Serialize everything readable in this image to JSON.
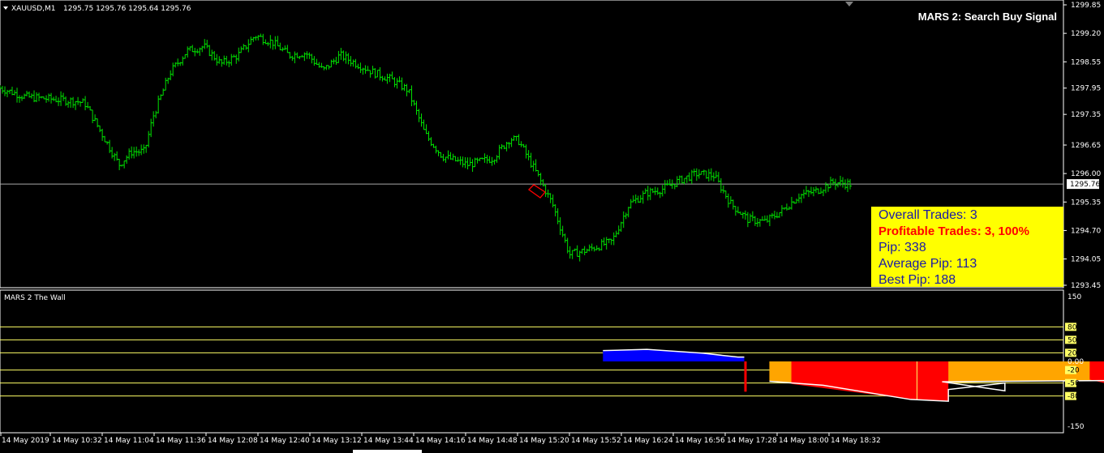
{
  "header": {
    "symbol": "XAUUSD,M1",
    "ohlc": "1295.75 1295.76 1295.64 1295.76",
    "signal": "MARS 2: Search Buy Signal"
  },
  "indicator_title": "MARS 2 The Wall",
  "stats": {
    "overall": "Overall Trades: 3",
    "profitable": "Profitable Trades: 3, 100%",
    "pip": "Pip: 338",
    "avg": "Average Pip: 113",
    "best": "Best Pip: 188"
  },
  "colors": {
    "candle": "#00e000",
    "hline": "#a8a8a8",
    "blue": "#0000ff",
    "orange": "#ffa500",
    "red": "#ff0000",
    "level": "#ffff66",
    "stats_bg": "#ffff00"
  },
  "chart_data": [
    {
      "type": "bar",
      "title": "XAUUSD,M1",
      "x_labels": [
        "14 May 2019",
        "14 May 10:32",
        "14 May 11:04",
        "14 May 11:36",
        "14 May 12:08",
        "14 May 12:40",
        "14 May 13:12",
        "14 May 13:44",
        "14 May 14:16",
        "14 May 14:48",
        "14 May 15:20",
        "14 May 15:52",
        "14 May 16:24",
        "14 May 16:56",
        "14 May 17:28",
        "14 May 18:00",
        "14 May 18:32"
      ],
      "y_ticks": [
        "1299.85",
        "1299.20",
        "1298.55",
        "1297.95",
        "1297.35",
        "1296.65",
        "1296.00",
        "1295.35",
        "1294.70",
        "1294.05",
        "1293.45"
      ],
      "ylim": [
        1293.45,
        1299.85
      ],
      "current_price": "1295.76",
      "price_path": [
        [
          0,
          1297.95
        ],
        [
          0.03,
          1297.75
        ],
        [
          0.06,
          1297.7
        ],
        [
          0.09,
          1297.65
        ],
        [
          0.1,
          1297.6
        ],
        [
          0.12,
          1296.9
        ],
        [
          0.14,
          1296.2
        ],
        [
          0.155,
          1296.5
        ],
        [
          0.17,
          1296.5
        ],
        [
          0.18,
          1297.3
        ],
        [
          0.2,
          1298.3
        ],
        [
          0.22,
          1298.8
        ],
        [
          0.24,
          1298.9
        ],
        [
          0.26,
          1298.5
        ],
        [
          0.28,
          1298.7
        ],
        [
          0.3,
          1299.15
        ],
        [
          0.32,
          1299.0
        ],
        [
          0.34,
          1298.7
        ],
        [
          0.36,
          1298.75
        ],
        [
          0.38,
          1298.35
        ],
        [
          0.4,
          1298.7
        ],
        [
          0.42,
          1298.5
        ],
        [
          0.44,
          1298.3
        ],
        [
          0.46,
          1298.15
        ],
        [
          0.48,
          1297.9
        ],
        [
          0.5,
          1296.9
        ],
        [
          0.52,
          1296.4
        ],
        [
          0.55,
          1296.2
        ],
        [
          0.58,
          1296.35
        ],
        [
          0.6,
          1296.8
        ],
        [
          0.61,
          1296.75
        ],
        [
          0.63,
          1296.05
        ],
        [
          0.65,
          1295.3
        ],
        [
          0.67,
          1294.15
        ],
        [
          0.69,
          1294.25
        ],
        [
          0.72,
          1294.45
        ],
        [
          0.74,
          1295.3
        ],
        [
          0.76,
          1295.55
        ],
        [
          0.78,
          1295.65
        ],
        [
          0.8,
          1295.85
        ],
        [
          0.82,
          1296.0
        ],
        [
          0.84,
          1295.95
        ],
        [
          0.86,
          1295.3
        ],
        [
          0.88,
          1294.95
        ],
        [
          0.9,
          1294.9
        ],
        [
          0.92,
          1295.15
        ],
        [
          0.94,
          1295.5
        ],
        [
          0.96,
          1295.6
        ],
        [
          0.98,
          1295.8
        ],
        [
          1.0,
          1295.76
        ]
      ]
    },
    {
      "type": "area",
      "title": "MARS 2 The Wall",
      "y_ticks": [
        "150",
        "80",
        "50",
        "20",
        "0.00",
        "-20",
        "-50",
        "-80",
        "-150"
      ],
      "levels": [
        80,
        50,
        20,
        -20,
        -50,
        -80
      ],
      "ylim": [
        -150,
        150
      ],
      "blue_area": [
        [
          13.12,
          25
        ],
        [
          13.26,
          28
        ],
        [
          13.44,
          19
        ],
        [
          13.55,
          10
        ],
        [
          13.57,
          10
        ]
      ],
      "orange_areas": [
        [
          14.05,
          -46
        ],
        [
          14.22,
          -55
        ],
        [
          14.8,
          -47
        ],
        [
          15.55,
          -44
        ],
        [
          16.2,
          -48
        ],
        [
          17.12,
          -15
        ],
        [
          17.65,
          -50
        ],
        [
          18.1,
          -45
        ],
        [
          18.32,
          -18
        ]
      ],
      "red_areas": [
        [
          14.12,
          -52
        ],
        [
          14.5,
          -88
        ],
        [
          14.62,
          -92
        ],
        [
          14.7,
          -55
        ],
        [
          15.7,
          -82
        ],
        [
          16.0,
          -70
        ]
      ]
    }
  ]
}
